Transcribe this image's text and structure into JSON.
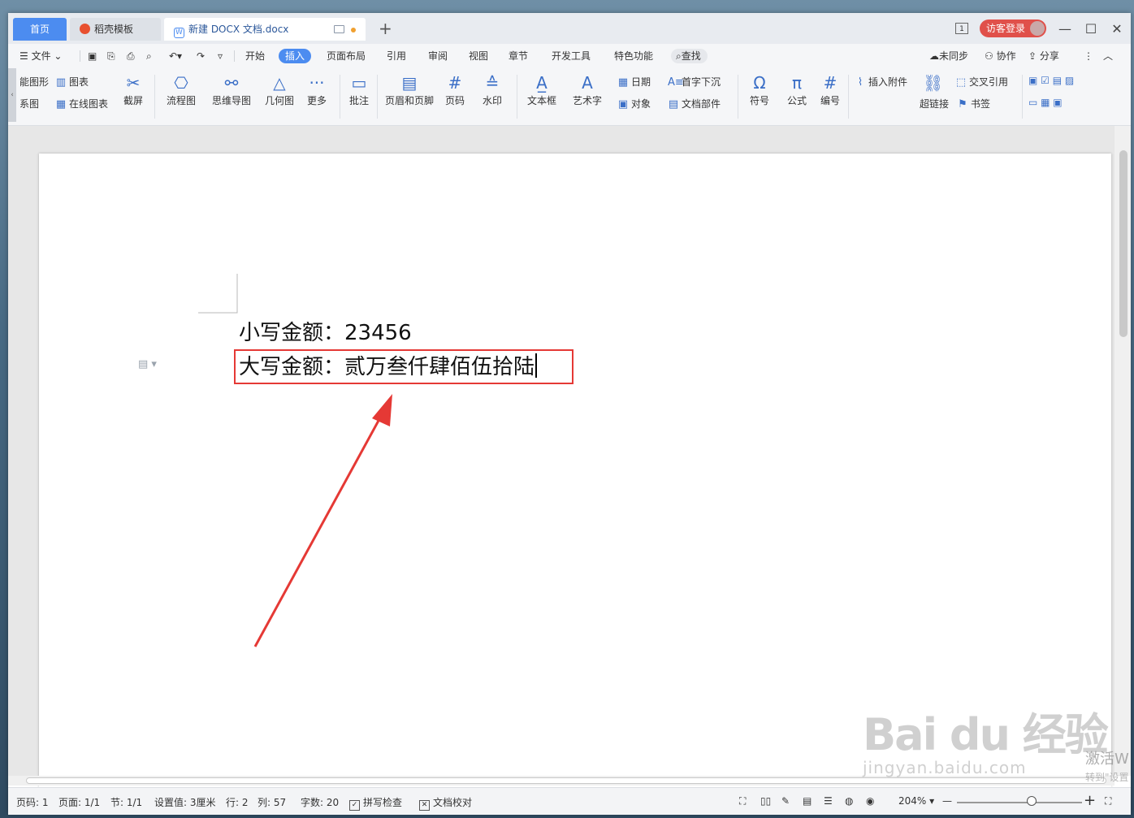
{
  "tabs": {
    "home": "首页",
    "docer": "稻壳模板",
    "doc": "新建 DOCX 文档.docx",
    "new": "+"
  },
  "titlebar": {
    "page_indicator": "1",
    "login": "访客登录",
    "minimize": "—",
    "maximize": "☐",
    "close": "✕"
  },
  "menu": {
    "file": "文件",
    "tabs": [
      "开始",
      "插入",
      "页面布局",
      "引用",
      "审阅",
      "视图",
      "章节",
      "开发工具",
      "特色功能"
    ],
    "search": "查找",
    "unsync": "未同步",
    "collab": "协作",
    "share": "分享"
  },
  "ribbon": {
    "smartart": "能图形",
    "chart": "图表",
    "relation": "系图",
    "online_chart": "在线图表",
    "screenshot": "截屏",
    "flowchart": "流程图",
    "mindmap": "思维导图",
    "geometry": "几何图",
    "more": "更多",
    "comment": "批注",
    "header_footer": "页眉和页脚",
    "page_number": "页码",
    "watermark": "水印",
    "textbox": "文本框",
    "wordart": "艺术字",
    "date": "日期",
    "object": "对象",
    "dropcap": "首字下沉",
    "docpart": "文档部件",
    "symbol": "符号",
    "formula": "公式",
    "numbering": "编号",
    "attachment": "插入附件",
    "hyperlink": "超链接",
    "crossref": "交叉引用",
    "bookmark": "书签"
  },
  "document": {
    "line1_label": "小写金额：",
    "line1_value": "23456",
    "line2_label": "大写金额：",
    "line2_value": "贰万叁仟肆佰伍拾陆"
  },
  "status": {
    "page_no": "页码: 1",
    "pages": "页面: 1/1",
    "section": "节: 1/1",
    "setting": "设置值: 3厘米",
    "row": "行: 2",
    "col": "列: 57",
    "wordcount": "字数: 20",
    "spellcheck": "拼写检查",
    "proofread": "文档校对",
    "zoom": "204%"
  },
  "overlay": {
    "watermark_line1": "Bai du 经验",
    "watermark_line2": "jingyan.baidu.com",
    "activate": "激活W",
    "activate_sub": "转到\"设置"
  },
  "colors": {
    "accent": "#4c8cf0",
    "highlight_box": "#e53935",
    "login": "#e0504a"
  }
}
